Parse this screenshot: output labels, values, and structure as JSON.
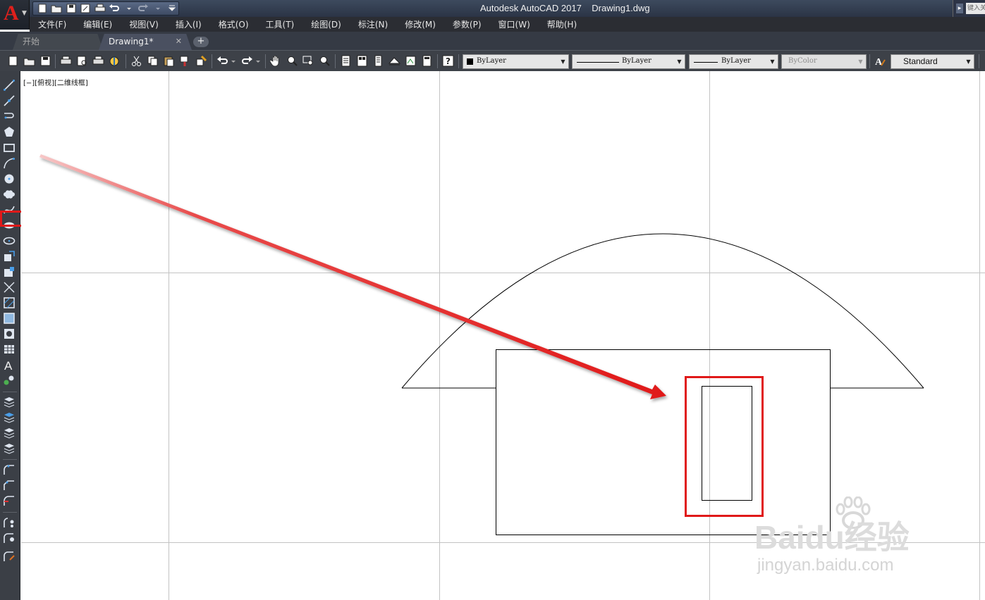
{
  "window": {
    "app_logo": "A",
    "title": "Autodesk AutoCAD 2017    Drawing1.dwg",
    "search_placeholder": "键入关"
  },
  "menu": {
    "items": [
      "文件(F)",
      "编辑(E)",
      "视图(V)",
      "插入(I)",
      "格式(O)",
      "工具(T)",
      "绘图(D)",
      "标注(N)",
      "修改(M)",
      "参数(P)",
      "窗口(W)",
      "帮助(H)"
    ]
  },
  "tabs": {
    "start": "开始",
    "drawing": "Drawing1*",
    "close": "✕",
    "add": "+"
  },
  "properties": {
    "color": "ByLayer",
    "linetype": "ByLayer",
    "lineweight": "ByLayer",
    "plotstyle": "ByColor",
    "textstyle": "Standard"
  },
  "viewport": {
    "label": "[−][俯视][二维线框]"
  },
  "annotation": {
    "highlight_color": "#e01919",
    "arrow_color": "#e01919"
  },
  "watermark": {
    "brand": "Baidu经验",
    "url": "jingyan.baidu.com"
  },
  "colors": {
    "canvas_bg": "#ffffff",
    "grid": "#bfbfbf",
    "drawing_line": "#000000",
    "chrome_dark": "#2b2d33"
  }
}
